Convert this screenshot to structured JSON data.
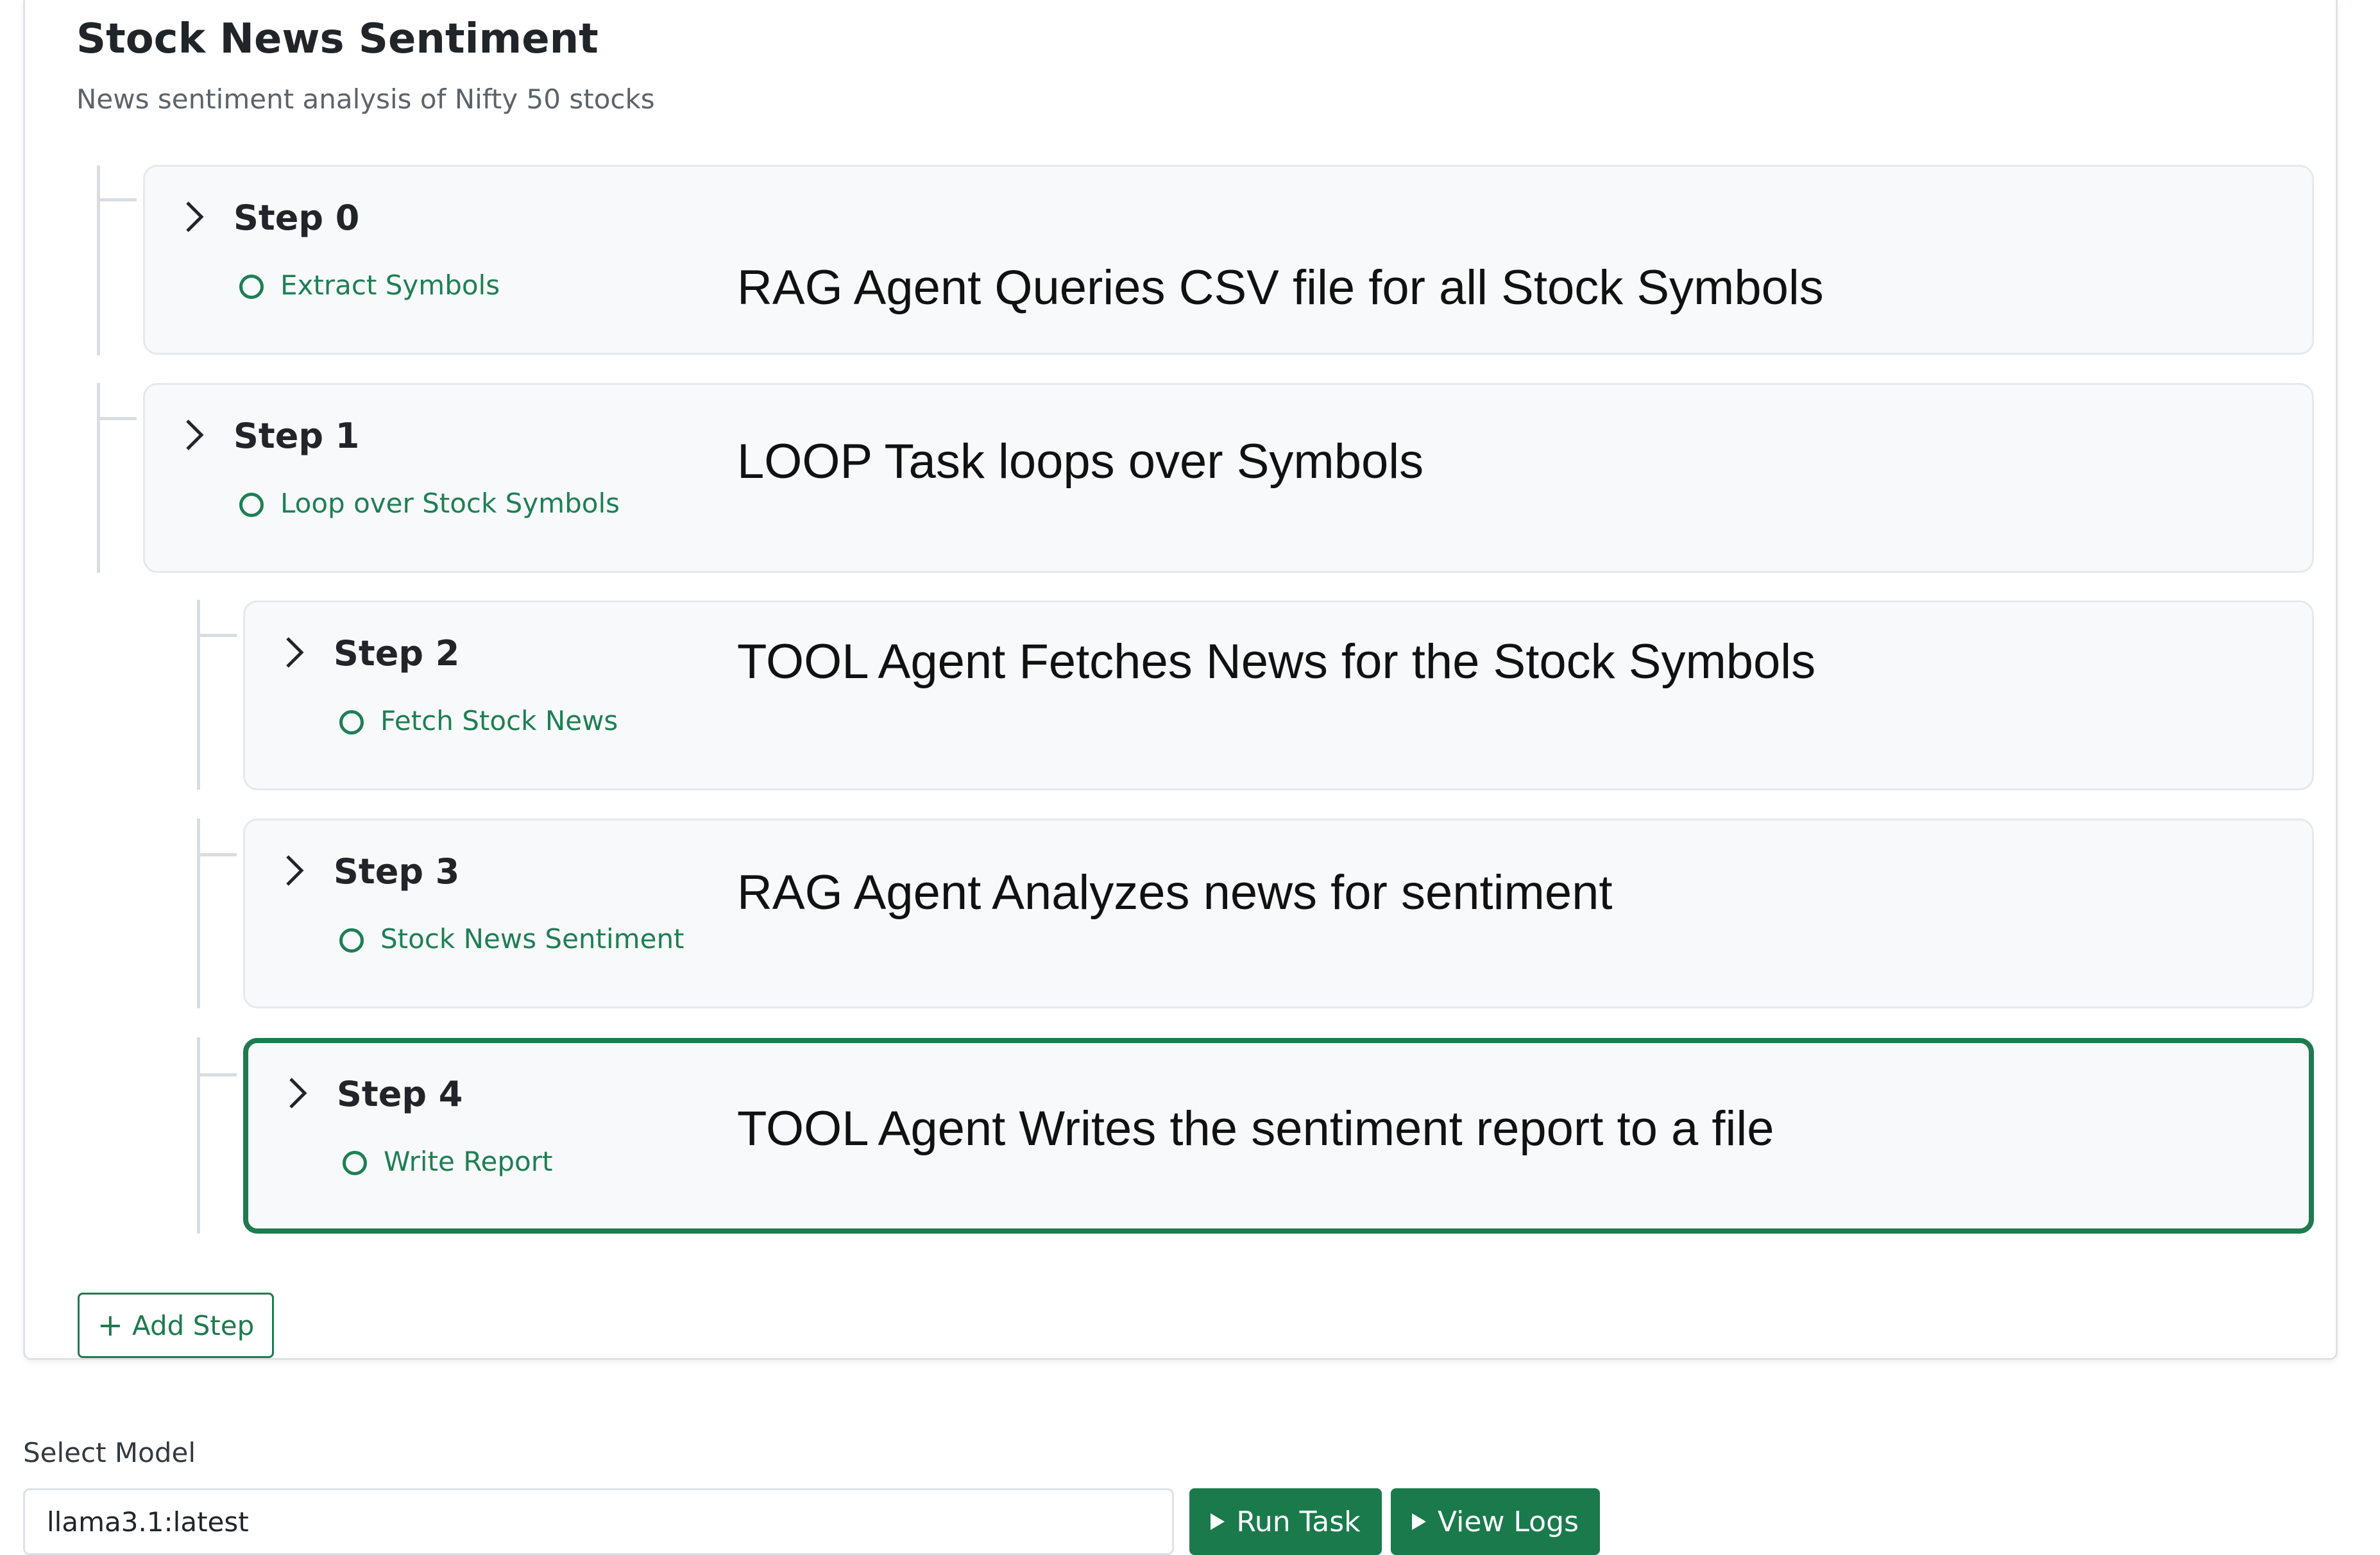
{
  "workflow": {
    "title": "Stock News Sentiment",
    "description": "News sentiment analysis of Nifty 50 stocks"
  },
  "steps": [
    {
      "label": "Step 0",
      "task": "Extract Symbols",
      "annotation": "RAG Agent Queries CSV file for all Stock Symbols"
    },
    {
      "label": "Step 1",
      "task": "Loop over Stock Symbols",
      "annotation": "LOOP Task loops over Symbols"
    },
    {
      "label": "Step 2",
      "task": "Fetch Stock News",
      "annotation": "TOOL Agent Fetches News for the Stock Symbols"
    },
    {
      "label": "Step 3",
      "task": "Stock News Sentiment",
      "annotation": "RAG Agent Analyzes news for sentiment"
    },
    {
      "label": "Step 4",
      "task": "Write Report",
      "annotation": "TOOL Agent Writes the sentiment report to a file"
    }
  ],
  "actions": {
    "add_step": "Add Step"
  },
  "model": {
    "label": "Select Model",
    "value": "llama3.1:latest"
  },
  "buttons": {
    "run_task": "Run Task",
    "view_logs": "View Logs"
  },
  "colors": {
    "accent": "#1f7a4f",
    "step_background": "#f8f9fa"
  },
  "icons": [
    "chevron-right-icon",
    "status-circle-icon",
    "plus-icon",
    "play-icon"
  ]
}
